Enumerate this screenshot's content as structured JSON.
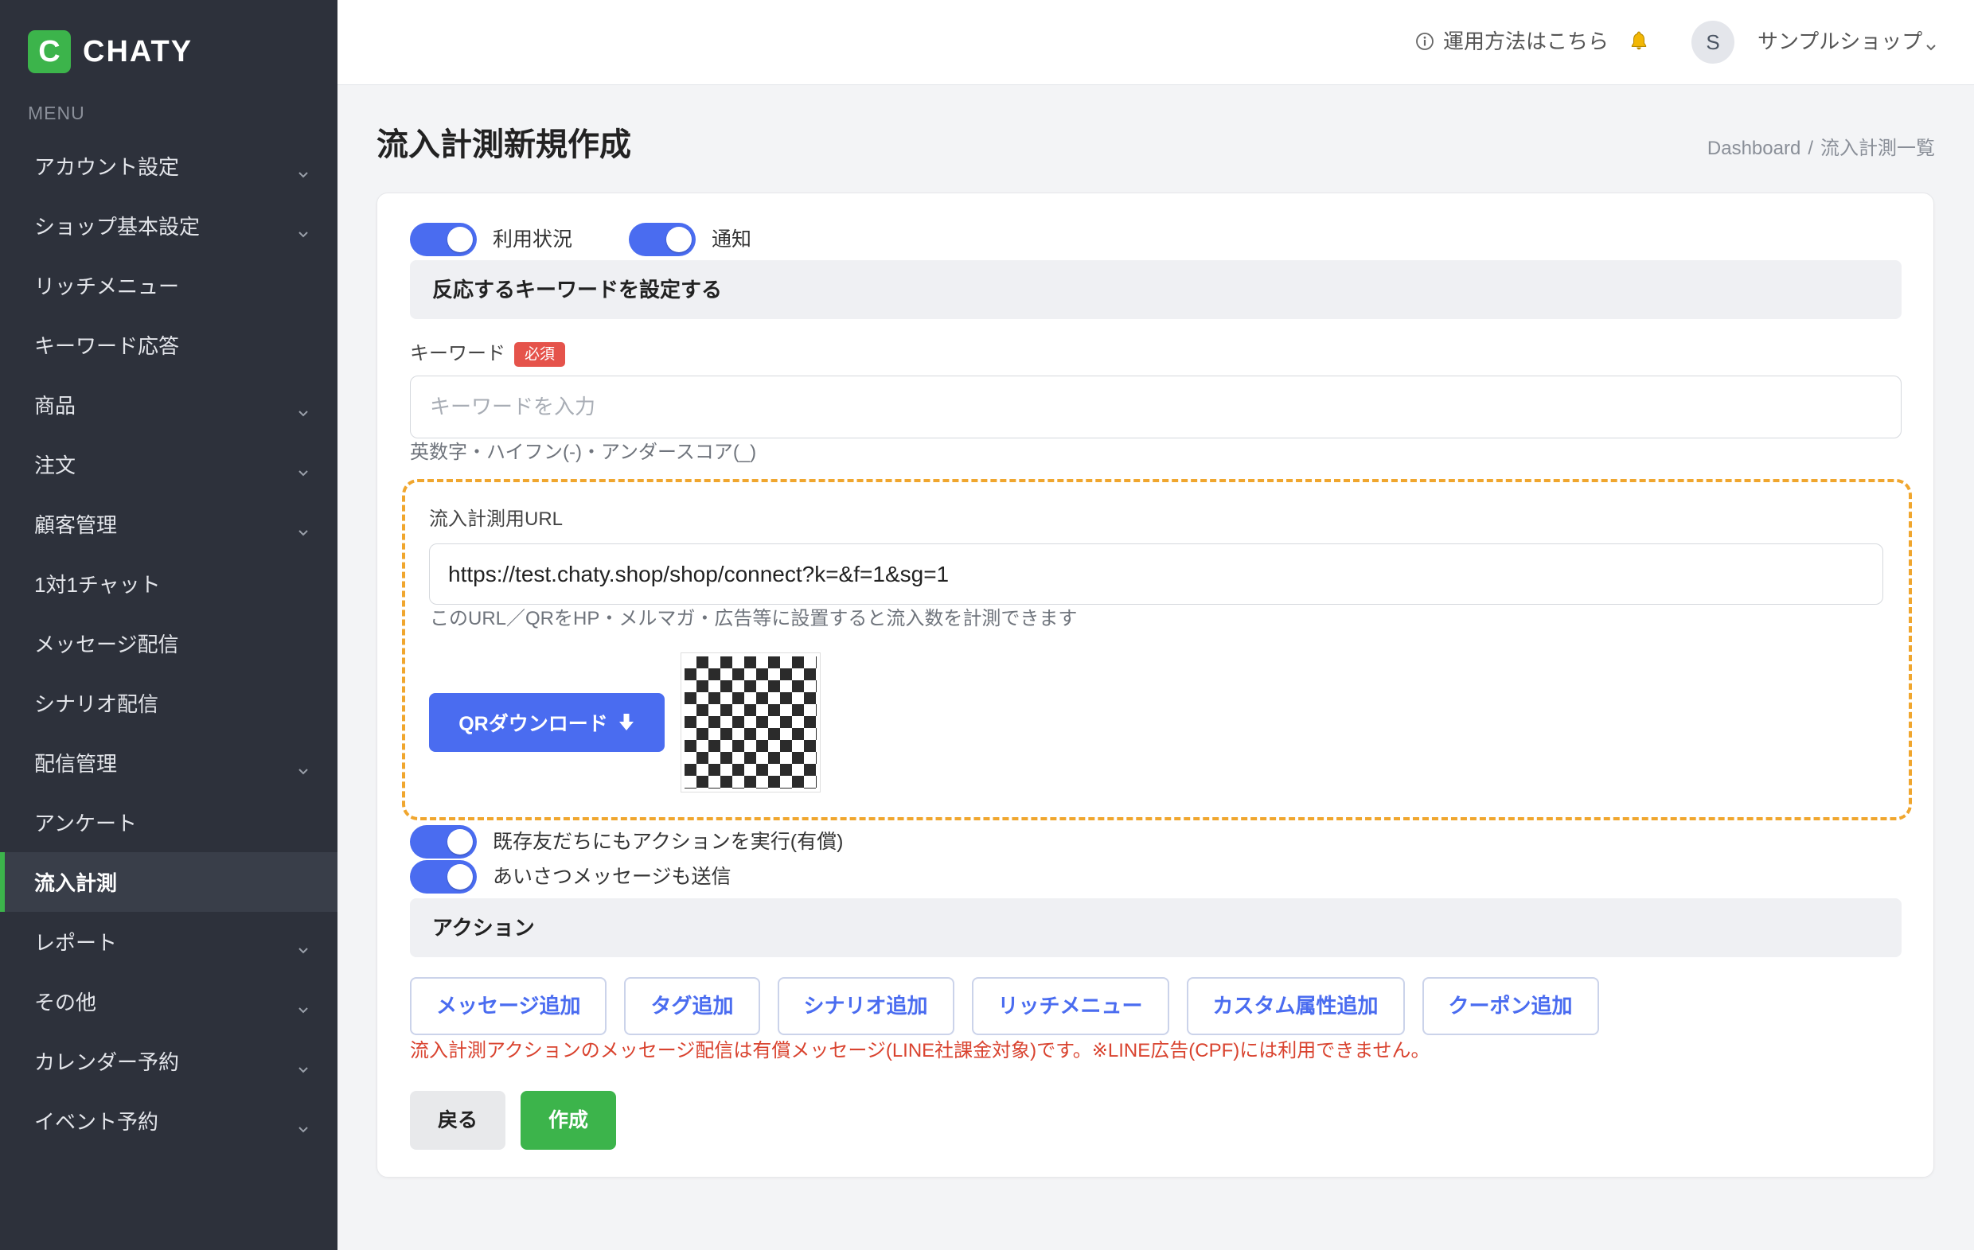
{
  "colors": {
    "accent": "#4a6cf0",
    "brand_green": "#3cb44b",
    "sidebar_bg": "#2d313b",
    "danger": "#d9432f",
    "badge_red": "#e5534b",
    "highlight_border": "#f0a62e"
  },
  "app": {
    "logo_letter": "C",
    "name": "CHATY"
  },
  "sidebar": {
    "section_label": "MENU",
    "items": [
      {
        "label": "アカウント設定",
        "icon": "chevron-down-icon"
      },
      {
        "label": "ショップ基本設定",
        "icon": "chevron-down-icon"
      },
      {
        "label": "リッチメニュー"
      },
      {
        "label": "キーワード応答"
      },
      {
        "label": "商品",
        "icon": "chevron-down-icon"
      },
      {
        "label": "注文",
        "icon": "chevron-down-icon"
      },
      {
        "label": "顧客管理",
        "icon": "chevron-down-icon"
      },
      {
        "label": "1対1チャット"
      },
      {
        "label": "メッセージ配信"
      },
      {
        "label": "シナリオ配信"
      },
      {
        "label": "配信管理",
        "icon": "chevron-down-icon"
      },
      {
        "label": "アンケート"
      },
      {
        "label": "流入計測",
        "active": true
      },
      {
        "label": "レポート",
        "icon": "chevron-down-icon"
      },
      {
        "label": "その他",
        "icon": "chevron-down-icon"
      },
      {
        "label": "カレンダー予約",
        "icon": "chevron-down-icon"
      },
      {
        "label": "イベント予約",
        "icon": "chevron-down-icon"
      }
    ]
  },
  "header": {
    "help_icon": "info-icon",
    "help_label": "運用方法はこちら",
    "notification_icon": "bell-icon",
    "avatar_initial": "S",
    "shop_name": "サンプルショップ",
    "shop_menu_icon": "chevron-down-icon"
  },
  "page": {
    "title": "流入計測新規作成",
    "breadcrumb": {
      "items": [
        "Dashboard",
        "流入計測一覧"
      ],
      "separator": "/"
    }
  },
  "form": {
    "toggles": [
      {
        "label": "利用状況",
        "on": true
      },
      {
        "label": "通知",
        "on": true
      }
    ],
    "keyword_section": {
      "title": "反応するキーワードを設定する",
      "keyword_label": "キーワード",
      "required_badge": "必須",
      "keyword_value": "",
      "keyword_placeholder": "キーワードを入力",
      "keyword_hint": "英数字・ハイフン(-)・アンダースコア(_)"
    },
    "tracking": {
      "url_label": "流入計測用URL",
      "url_value": "https://test.chaty.shop/shop/connect?k=&f=1&sg=1",
      "url_hint": "このURL／QRをHP・メルマガ・広告等に設置すると流入数を計測できます",
      "qr_download_label": "QRダウンロード",
      "qr_download_icon": "download-icon"
    },
    "options": [
      {
        "label": "既存友だちにもアクションを実行(有償)",
        "on": true
      },
      {
        "label": "あいさつメッセージも送信",
        "on": true
      }
    ],
    "action_section": {
      "title": "アクション",
      "buttons": [
        "メッセージ追加",
        "タグ追加",
        "シナリオ追加",
        "リッチメニュー",
        "カスタム属性追加",
        "クーポン追加"
      ],
      "note": "流入計測アクションのメッセージ配信は有償メッセージ(LINE社課金対象)です。※LINE広告(CPF)には利用できません。"
    },
    "footer": {
      "back_label": "戻る",
      "submit_label": "作成"
    }
  }
}
